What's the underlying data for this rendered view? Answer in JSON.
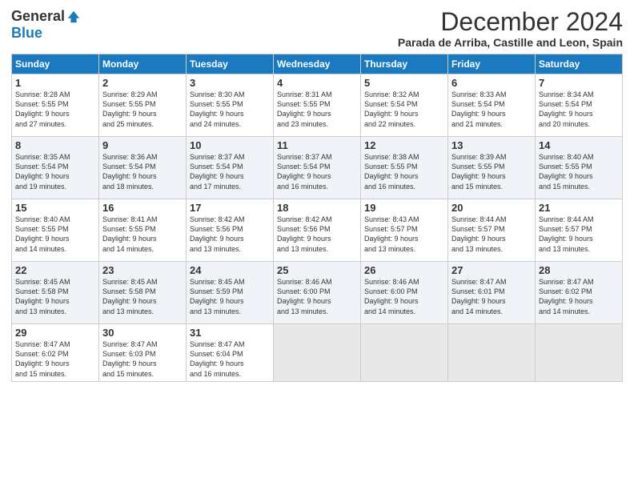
{
  "logo": {
    "general": "General",
    "blue": "Blue"
  },
  "title": "December 2024",
  "location": "Parada de Arriba, Castille and Leon, Spain",
  "headers": [
    "Sunday",
    "Monday",
    "Tuesday",
    "Wednesday",
    "Thursday",
    "Friday",
    "Saturday"
  ],
  "weeks": [
    [
      {
        "day": "1",
        "info": "Sunrise: 8:28 AM\nSunset: 5:55 PM\nDaylight: 9 hours\nand 27 minutes."
      },
      {
        "day": "2",
        "info": "Sunrise: 8:29 AM\nSunset: 5:55 PM\nDaylight: 9 hours\nand 25 minutes."
      },
      {
        "day": "3",
        "info": "Sunrise: 8:30 AM\nSunset: 5:55 PM\nDaylight: 9 hours\nand 24 minutes."
      },
      {
        "day": "4",
        "info": "Sunrise: 8:31 AM\nSunset: 5:55 PM\nDaylight: 9 hours\nand 23 minutes."
      },
      {
        "day": "5",
        "info": "Sunrise: 8:32 AM\nSunset: 5:54 PM\nDaylight: 9 hours\nand 22 minutes."
      },
      {
        "day": "6",
        "info": "Sunrise: 8:33 AM\nSunset: 5:54 PM\nDaylight: 9 hours\nand 21 minutes."
      },
      {
        "day": "7",
        "info": "Sunrise: 8:34 AM\nSunset: 5:54 PM\nDaylight: 9 hours\nand 20 minutes."
      }
    ],
    [
      {
        "day": "8",
        "info": "Sunrise: 8:35 AM\nSunset: 5:54 PM\nDaylight: 9 hours\nand 19 minutes."
      },
      {
        "day": "9",
        "info": "Sunrise: 8:36 AM\nSunset: 5:54 PM\nDaylight: 9 hours\nand 18 minutes."
      },
      {
        "day": "10",
        "info": "Sunrise: 8:37 AM\nSunset: 5:54 PM\nDaylight: 9 hours\nand 17 minutes."
      },
      {
        "day": "11",
        "info": "Sunrise: 8:37 AM\nSunset: 5:54 PM\nDaylight: 9 hours\nand 16 minutes."
      },
      {
        "day": "12",
        "info": "Sunrise: 8:38 AM\nSunset: 5:55 PM\nDaylight: 9 hours\nand 16 minutes."
      },
      {
        "day": "13",
        "info": "Sunrise: 8:39 AM\nSunset: 5:55 PM\nDaylight: 9 hours\nand 15 minutes."
      },
      {
        "day": "14",
        "info": "Sunrise: 8:40 AM\nSunset: 5:55 PM\nDaylight: 9 hours\nand 15 minutes."
      }
    ],
    [
      {
        "day": "15",
        "info": "Sunrise: 8:40 AM\nSunset: 5:55 PM\nDaylight: 9 hours\nand 14 minutes."
      },
      {
        "day": "16",
        "info": "Sunrise: 8:41 AM\nSunset: 5:55 PM\nDaylight: 9 hours\nand 14 minutes."
      },
      {
        "day": "17",
        "info": "Sunrise: 8:42 AM\nSunset: 5:56 PM\nDaylight: 9 hours\nand 13 minutes."
      },
      {
        "day": "18",
        "info": "Sunrise: 8:42 AM\nSunset: 5:56 PM\nDaylight: 9 hours\nand 13 minutes."
      },
      {
        "day": "19",
        "info": "Sunrise: 8:43 AM\nSunset: 5:57 PM\nDaylight: 9 hours\nand 13 minutes."
      },
      {
        "day": "20",
        "info": "Sunrise: 8:44 AM\nSunset: 5:57 PM\nDaylight: 9 hours\nand 13 minutes."
      },
      {
        "day": "21",
        "info": "Sunrise: 8:44 AM\nSunset: 5:57 PM\nDaylight: 9 hours\nand 13 minutes."
      }
    ],
    [
      {
        "day": "22",
        "info": "Sunrise: 8:45 AM\nSunset: 5:58 PM\nDaylight: 9 hours\nand 13 minutes."
      },
      {
        "day": "23",
        "info": "Sunrise: 8:45 AM\nSunset: 5:58 PM\nDaylight: 9 hours\nand 13 minutes."
      },
      {
        "day": "24",
        "info": "Sunrise: 8:45 AM\nSunset: 5:59 PM\nDaylight: 9 hours\nand 13 minutes."
      },
      {
        "day": "25",
        "info": "Sunrise: 8:46 AM\nSunset: 6:00 PM\nDaylight: 9 hours\nand 13 minutes."
      },
      {
        "day": "26",
        "info": "Sunrise: 8:46 AM\nSunset: 6:00 PM\nDaylight: 9 hours\nand 14 minutes."
      },
      {
        "day": "27",
        "info": "Sunrise: 8:47 AM\nSunset: 6:01 PM\nDaylight: 9 hours\nand 14 minutes."
      },
      {
        "day": "28",
        "info": "Sunrise: 8:47 AM\nSunset: 6:02 PM\nDaylight: 9 hours\nand 14 minutes."
      }
    ],
    [
      {
        "day": "29",
        "info": "Sunrise: 8:47 AM\nSunset: 6:02 PM\nDaylight: 9 hours\nand 15 minutes."
      },
      {
        "day": "30",
        "info": "Sunrise: 8:47 AM\nSunset: 6:03 PM\nDaylight: 9 hours\nand 15 minutes."
      },
      {
        "day": "31",
        "info": "Sunrise: 8:47 AM\nSunset: 6:04 PM\nDaylight: 9 hours\nand 16 minutes."
      },
      {
        "day": "",
        "info": ""
      },
      {
        "day": "",
        "info": ""
      },
      {
        "day": "",
        "info": ""
      },
      {
        "day": "",
        "info": ""
      }
    ]
  ]
}
